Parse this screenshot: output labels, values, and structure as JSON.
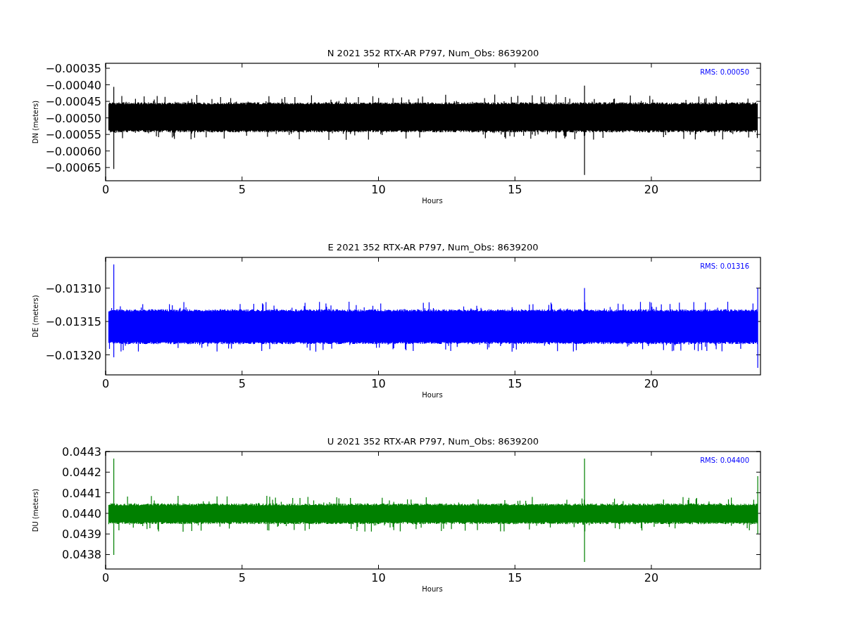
{
  "panels": [
    {
      "chart_data": {
        "type": "line",
        "title": "N 2021 352 RTX-AR  P797, Num_Obs: 8639200",
        "xlabel": "Hours",
        "ylabel": "DN (meters)",
        "xlim": [
          0,
          24
        ],
        "ylim": [
          -0.00069,
          -0.000335
        ],
        "xticks": [
          0,
          5,
          10,
          15,
          20
        ],
        "yticks": [
          {
            "value": -0.00035,
            "label": "−0.00035"
          },
          {
            "value": -0.0004,
            "label": "−0.00040"
          },
          {
            "value": -0.00045,
            "label": "−0.00045"
          },
          {
            "value": -0.0005,
            "label": "−0.00050"
          },
          {
            "value": -0.00055,
            "label": "−0.00055"
          },
          {
            "value": -0.0006,
            "label": "−0.00060"
          },
          {
            "value": -0.00065,
            "label": "−0.00065"
          }
        ],
        "grid": false,
        "annotations": [
          "RMS:  0.00050"
        ]
      }
    },
    {
      "chart_data": {
        "type": "line",
        "title": "E 2021 352 RTX-AR  P797, Num_Obs: 8639200",
        "xlabel": "Hours",
        "ylabel": "DE (meters)",
        "xlim": [
          0,
          24
        ],
        "ylim": [
          -0.01323,
          -0.013054
        ],
        "xticks": [
          0,
          5,
          10,
          15,
          20
        ],
        "yticks": [
          {
            "value": -0.0131,
            "label": "−0.01310"
          },
          {
            "value": -0.01315,
            "label": "−0.01315"
          },
          {
            "value": -0.0132,
            "label": "−0.01320"
          }
        ],
        "grid": false,
        "annotations": [
          "RMS:  0.01316"
        ]
      }
    },
    {
      "chart_data": {
        "type": "line",
        "title": "U 2021 352 RTX-AR  P797, Num_Obs: 8639200",
        "xlabel": "Hours",
        "ylabel": "DU (meters)",
        "xlim": [
          0,
          24
        ],
        "ylim": [
          0.04373,
          0.0443
        ],
        "xticks": [
          0,
          5,
          10,
          15,
          20
        ],
        "yticks": [
          {
            "value": 0.0443,
            "label": "0.0443"
          },
          {
            "value": 0.0442,
            "label": "0.0442"
          },
          {
            "value": 0.0441,
            "label": "0.0441"
          },
          {
            "value": 0.044,
            "label": "0.0440"
          },
          {
            "value": 0.0439,
            "label": "0.0439"
          },
          {
            "value": 0.0438,
            "label": "0.0438"
          }
        ],
        "grid": false,
        "annotations": [
          "RMS:  0.04400"
        ]
      }
    }
  ]
}
